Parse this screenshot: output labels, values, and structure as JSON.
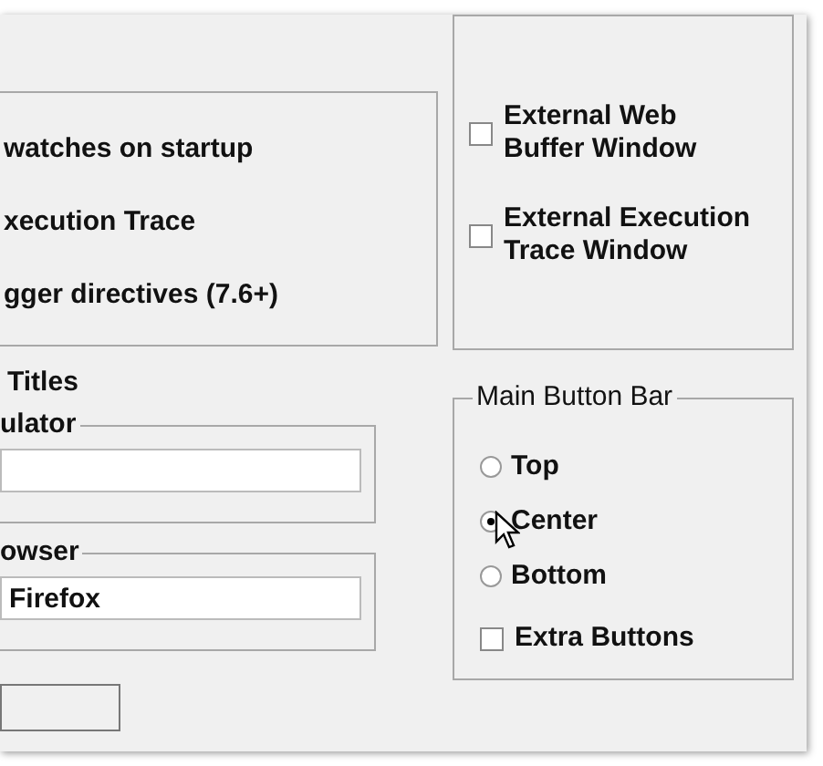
{
  "startup_group": {
    "options": [
      {
        "label": "watches on startup"
      },
      {
        "label": "xecution Trace"
      },
      {
        "label": "gger directives (7.6+)"
      }
    ]
  },
  "titles_group": {
    "title": "Titles",
    "field_groups": [
      {
        "legend": "ulator"
      },
      {
        "legend": "owser",
        "value": "Firefox"
      }
    ]
  },
  "external_windows": [
    {
      "label": "External Web\nBuffer Window",
      "checked": false
    },
    {
      "label": "External Execution\nTrace Window",
      "checked": false
    }
  ],
  "main_button_bar": {
    "legend": "Main Button Bar",
    "options": [
      {
        "label": "Top",
        "selected": false
      },
      {
        "label": "Center",
        "selected": true
      },
      {
        "label": "Bottom",
        "selected": false
      }
    ],
    "extra": {
      "label": "Extra Buttons",
      "checked": false
    }
  }
}
